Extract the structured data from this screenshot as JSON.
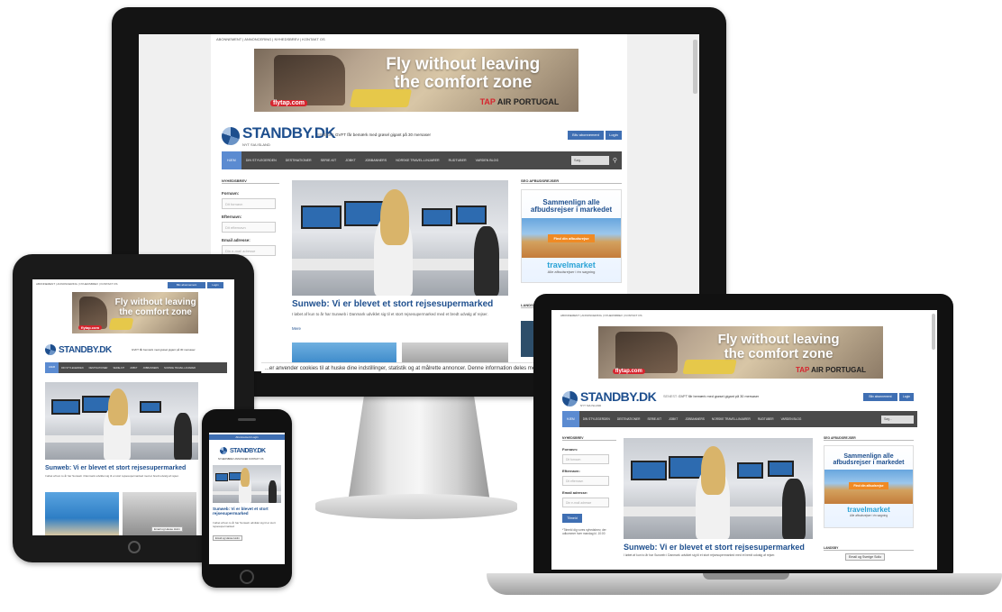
{
  "site": {
    "topbar": "ABONNEMENT | ANNONCERING | NYHEDSBREV | KONTAKT OS",
    "ad": {
      "headline_l1": "Fly without leaving",
      "headline_l2": "the comfort zone",
      "flytap": "flytap.com",
      "tap": "TAP",
      "airportugal": "AIR PORTUGAL"
    },
    "logo": {
      "name": "STANDBY.DK",
      "tagline": "NYT SIA ISLAND"
    },
    "ticker": {
      "label": "SENEST:",
      "text": "GVFT får bemærk med grøsel gigant på 30 mersaser"
    },
    "buttons": {
      "subscribe": "Bliv abonnement",
      "login": "Login"
    },
    "nav": [
      "HJEM",
      "DIN STYLEGERDEN",
      "DESTINATIONER",
      "SERIE-KIT",
      "JOBKT",
      "JOBBANNERS",
      "NORSKE TRAVEL-LINJARER",
      "RUDTUBER",
      "VARDEN BLOG"
    ],
    "search_placeholder": "Søg...",
    "sidebar": {
      "heading": "NYHEDSBREV",
      "firstname_label": "Fornavn:",
      "firstname_ph": "Dit fornavn",
      "lastname_label": "Efternavn:",
      "lastname_ph": "Dit efternavn",
      "email_label": "Email adresse:",
      "email_ph": "Din e-mail adresse",
      "submit": "Tilmeld",
      "note": "*Tilmeld dig vores nyhedsbrev, der udkommer hver mandag kl. 10:00"
    },
    "article": {
      "headline": "Sunweb: Vi er blevet et stort rejsesupermarked",
      "excerpt": "I løbet af kun to år har Sunweb i Danmark udviklet sig til et stort rejsesupermarked med et bredt udvalg af rejser.",
      "more": "Mere"
    },
    "right": {
      "heading": "SEO AFBUDSREJSER",
      "ad_line1": "Sammenlign alle",
      "ad_line2": "afbudsrejser i markedet",
      "ad_cta": "Find din afbudsrejse",
      "brand": "travelmarket",
      "brand_sub": "Alle afbudsrejser i én søgning",
      "heading2": "LANDSBY"
    },
    "cookie": "...er anvender cookies til at huske dine indstillinger, statistik og at målrette annoncer. Denne information deles med tredjeparter."
  },
  "phone": {
    "top_links": "Abonnement  Login",
    "tagline": "NYHEDSBREV  ANNONCER  KONTAKT OS",
    "headline": "Sunweb: Vi er blevet et stort rejsesupermarked",
    "excerpt": "I løbet af kun to år har Sunweb udviklet sig til et stort rejsesupermarked",
    "tooltip": "Email og Hasse Holm"
  },
  "laptop": {
    "tooltip": "Email og Sverige Sollo"
  }
}
